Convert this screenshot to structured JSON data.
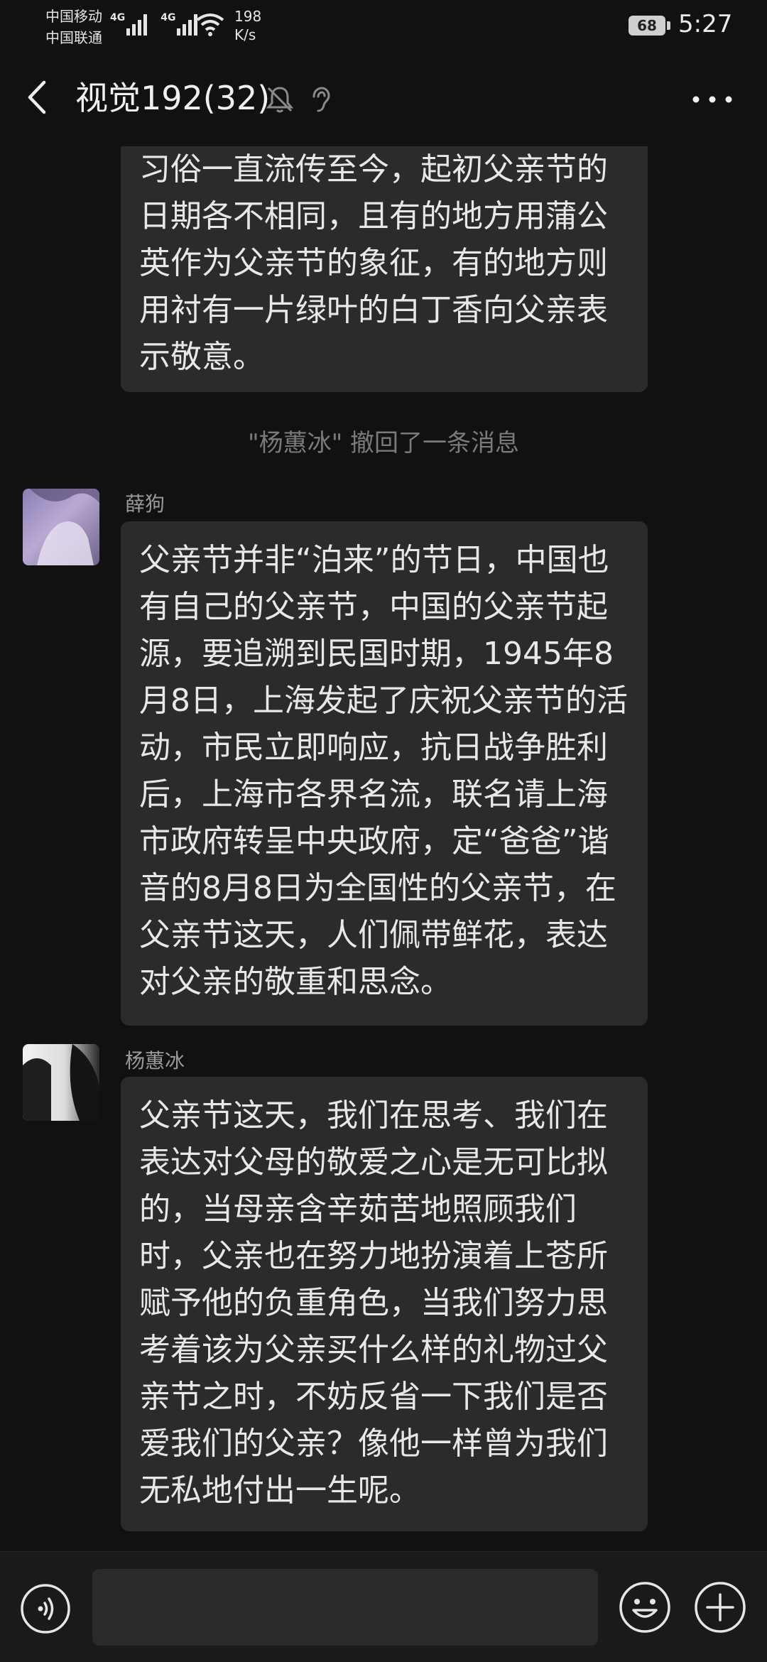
{
  "status_bar": {
    "carrier_1": "中国移动",
    "carrier_2": "中国联通",
    "sim1_tag": "4G",
    "sim2_tag": "4G",
    "net_speed_value": "198",
    "net_speed_unit": "K/s",
    "battery_level": "68",
    "time": "5:27",
    "icons": [
      "signal-icon",
      "signal-icon",
      "wifi-icon",
      "battery-icon"
    ]
  },
  "header": {
    "title": "视觉192(32)",
    "icons": [
      "back-icon",
      "mute-bell-icon",
      "ear-icon",
      "more-icon"
    ]
  },
  "messages": [
    {
      "sender": "",
      "text": "习俗一直流传至今，起初父亲节的日期各不相同，且有的地方用蒲公英作为父亲节的象征，有的地方则用衬有一片绿叶的白丁香向父亲表示敬意。"
    },
    {
      "sender": "薛狗",
      "text": "父亲节并非“泊来”的节日，中国也有自己的父亲节，中国的父亲节起源，要追溯到民国时期，1945年8月8日，上海发起了庆祝父亲节的活动，市民立即响应，抗日战争胜利后，上海市各界名流，联名请上海市政府转呈中央政府，定“爸爸”谐音的8月8日为全国性的父亲节，在父亲节这天，人们佩带鲜花，表达对父亲的敬重和思念。"
    },
    {
      "sender": "杨蕙冰",
      "text": "父亲节这天，我们在思考、我们在表达对父母的敬爱之心是无可比拟的，当母亲含辛茹苦地照顾我们时，父亲也在努力地扮演着上苍所赋予他的负重角色，当我们努力思考着该为父亲买什么样的礼物过父亲节之时，不妨反省一下我们是否爱我们的父亲？像他一样曾为我们无私地付出一生呢。"
    }
  ],
  "recall_notice": "\"杨蕙冰\" 撤回了一条消息",
  "input_bar": {
    "input_value": "",
    "icons": [
      "voice-icon",
      "emoji-icon",
      "plus-icon"
    ]
  },
  "colors": {
    "background": "#111111",
    "bubble": "#2b2b2b",
    "text": "#e8e8e8",
    "muted": "#9a9a9a"
  }
}
